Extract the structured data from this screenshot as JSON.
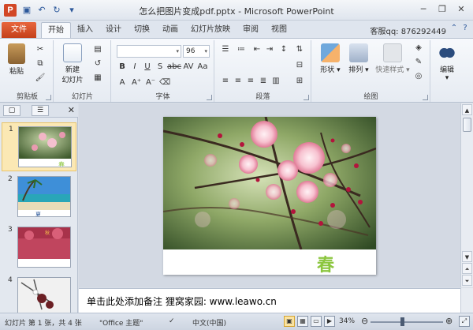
{
  "window": {
    "title": "怎么把图片变成pdf.pptx - Microsoft PowerPoint",
    "app_icon_letter": "P"
  },
  "tabs": {
    "file": "文件",
    "items": [
      "开始",
      "插入",
      "设计",
      "切换",
      "动画",
      "幻灯片放映",
      "审阅",
      "视图"
    ],
    "active": "开始"
  },
  "qq_text": "客服qq: 876292449",
  "ribbon": {
    "clipboard": {
      "label": "剪贴板",
      "paste": "粘贴"
    },
    "slides": {
      "label": "幻灯片",
      "new_slide_line1": "新建",
      "new_slide_line2": "幻灯片"
    },
    "font": {
      "label": "字体",
      "size_value": "96"
    },
    "paragraph": {
      "label": "段落"
    },
    "drawing": {
      "label": "绘图",
      "shapes": "形状",
      "arrange": "排列",
      "quick_styles": "快速样式"
    },
    "editing": {
      "label": "编辑"
    }
  },
  "slides_panel": {
    "thumbnails": [
      {
        "num": "1",
        "selected": true
      },
      {
        "num": "2",
        "selected": false
      },
      {
        "num": "3",
        "selected": false
      },
      {
        "num": "4",
        "selected": false
      }
    ]
  },
  "slide": {
    "caption": "春"
  },
  "notes": {
    "text": "单击此处添加备注  狸窝家园: www.leawo.cn"
  },
  "status": {
    "slide_info": "幻灯片 第 1 张，共 4 张",
    "theme": "\"Office 主题\"",
    "language": "中文(中国)",
    "zoom": "34%"
  },
  "colors": {
    "file_tab": "#d24726",
    "accent": "#2b579a",
    "chun_green": "#8cc63f"
  }
}
